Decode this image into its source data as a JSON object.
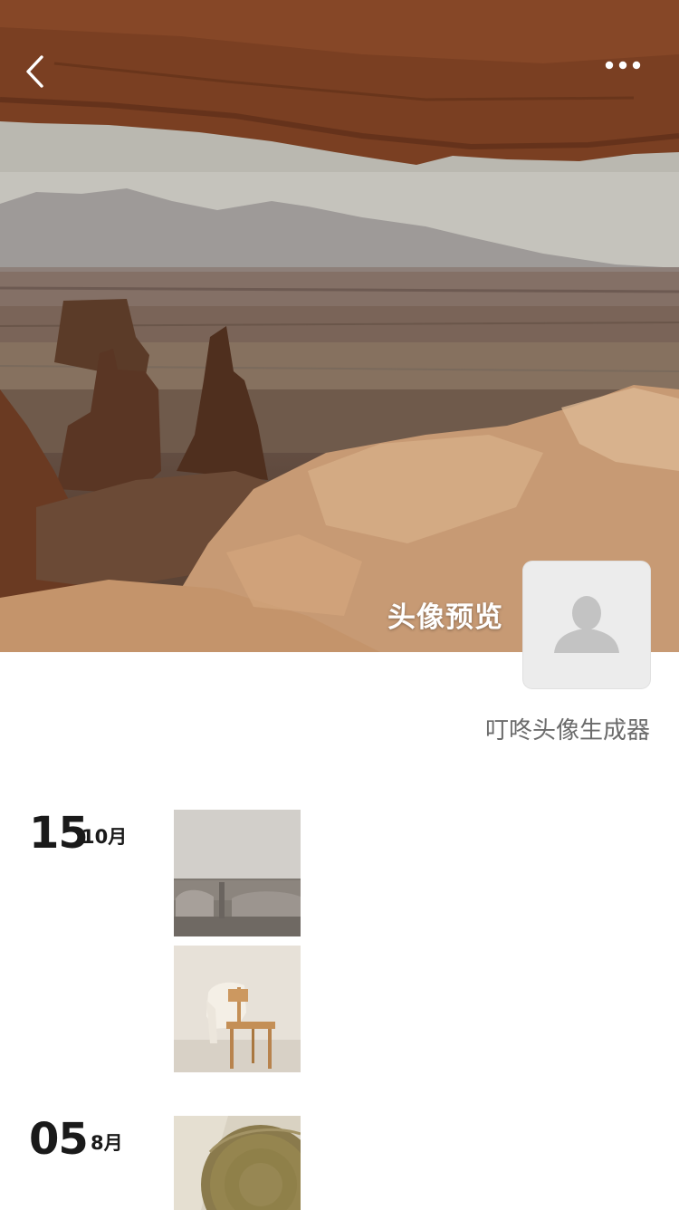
{
  "nav": {
    "back_icon": "chevron-left-icon",
    "more_icon": "more-dots-icon"
  },
  "profile": {
    "preview_label": "头像预览",
    "avatar_icon": "person-placeholder-icon",
    "app_name": "叮咚头像生成器"
  },
  "timeline": [
    {
      "day": "15",
      "month": "10月",
      "photos": [
        "sofa-photo",
        "chair-photo"
      ]
    },
    {
      "day": "05",
      "month": "8月",
      "photos": [
        "bowl-photo"
      ]
    }
  ]
}
